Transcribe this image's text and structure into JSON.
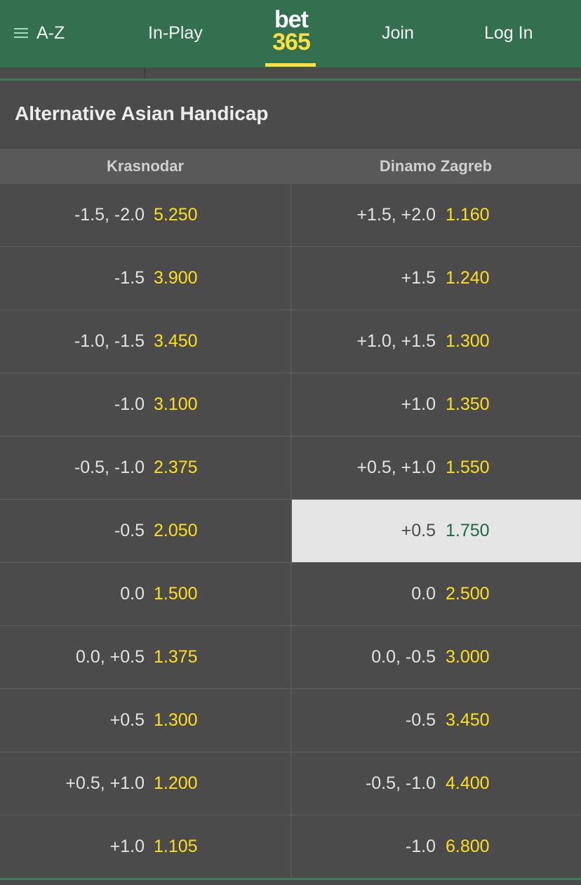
{
  "header": {
    "az_label": "A-Z",
    "inplay_label": "In-Play",
    "logo_top": "bet",
    "logo_bottom": "365",
    "join_label": "Join",
    "login_label": "Log In"
  },
  "market": {
    "title": "Alternative Asian Handicap",
    "team_home": "Krasnodar",
    "team_away": "Dinamo Zagreb",
    "selected": {
      "row": 5,
      "side": "away"
    },
    "rows": [
      {
        "home_hcp": "-1.5, -2.0",
        "home_odds": "5.250",
        "away_hcp": "+1.5, +2.0",
        "away_odds": "1.160"
      },
      {
        "home_hcp": "-1.5",
        "home_odds": "3.900",
        "away_hcp": "+1.5",
        "away_odds": "1.240"
      },
      {
        "home_hcp": "-1.0, -1.5",
        "home_odds": "3.450",
        "away_hcp": "+1.0, +1.5",
        "away_odds": "1.300"
      },
      {
        "home_hcp": "-1.0",
        "home_odds": "3.100",
        "away_hcp": "+1.0",
        "away_odds": "1.350"
      },
      {
        "home_hcp": "-0.5, -1.0",
        "home_odds": "2.375",
        "away_hcp": "+0.5, +1.0",
        "away_odds": "1.550"
      },
      {
        "home_hcp": "-0.5",
        "home_odds": "2.050",
        "away_hcp": "+0.5",
        "away_odds": "1.750"
      },
      {
        "home_hcp": "0.0",
        "home_odds": "1.500",
        "away_hcp": "0.0",
        "away_odds": "2.500"
      },
      {
        "home_hcp": "0.0, +0.5",
        "home_odds": "1.375",
        "away_hcp": "0.0, -0.5",
        "away_odds": "3.000"
      },
      {
        "home_hcp": "+0.5",
        "home_odds": "1.300",
        "away_hcp": "-0.5",
        "away_odds": "3.450"
      },
      {
        "home_hcp": "+0.5, +1.0",
        "home_odds": "1.200",
        "away_hcp": "-0.5, -1.0",
        "away_odds": "4.400"
      },
      {
        "home_hcp": "+1.0",
        "home_odds": "1.105",
        "away_hcp": "-1.0",
        "away_odds": "6.800"
      }
    ]
  },
  "colors": {
    "header_green": "#32704f",
    "odds_yellow": "#ffdf1b",
    "selected_bg": "#e5e5e5",
    "selected_odds": "#1c6a46"
  }
}
